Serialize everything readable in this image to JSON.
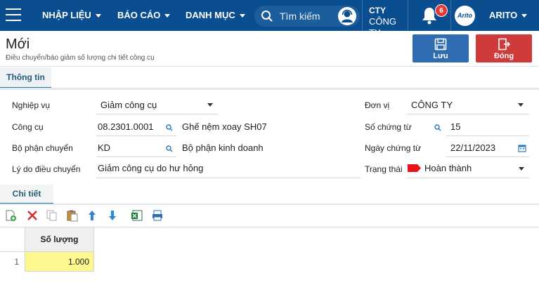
{
  "header": {
    "menu": [
      {
        "label": "NHẬP LIỆU"
      },
      {
        "label": "BÁO CÁO"
      },
      {
        "label": "DANH MỤC"
      }
    ],
    "search_placeholder": "Tìm kiếm",
    "company": {
      "line1": "CTY",
      "line2": "CÔNG TY"
    },
    "notifications_count": "6",
    "avatar_text": "Arito",
    "user": "ARITO"
  },
  "page": {
    "title": "Mới",
    "subtitle": "Điều chuyển/báo giảm số lượng chi tiết công cụ",
    "save_label": "Lưu",
    "close_label": "Đóng",
    "tab_info": "Thông tin"
  },
  "form": {
    "nghiep_vu": {
      "label": "Nghiệp vụ",
      "value": "Giảm công cụ"
    },
    "cong_cu": {
      "label": "Công cụ",
      "code": "08.2301.0001",
      "name": "Ghế nệm xoay SH07"
    },
    "bo_phan": {
      "label": "Bộ phận chuyển",
      "code": "KD",
      "name": "Bộ phận kinh doanh"
    },
    "ly_do": {
      "label": "Lý do điều chuyển",
      "value": "Giảm công cụ do hư hỏng"
    },
    "don_vi": {
      "label": "Đơn vị",
      "value": "CÔNG TY"
    },
    "so_chung_tu": {
      "label": "Số chứng từ",
      "value": "15"
    },
    "ngay_chung_tu": {
      "label": "Ngày chứng từ",
      "value": "22/11/2023"
    },
    "trang_thai": {
      "label": "Trạng thái",
      "value": "Hoàn thành",
      "flag_color": "#e8141c"
    }
  },
  "detail": {
    "tab_label": "Chi tiết",
    "columns": [
      "Số lượng"
    ],
    "rows": [
      {
        "index": "1",
        "so_luong": "1.000"
      }
    ]
  },
  "colors": {
    "topbar": "#0a4e8f",
    "save": "#2f6db3",
    "close": "#cf3a3a",
    "highlight_cell": "#fcf88e"
  }
}
